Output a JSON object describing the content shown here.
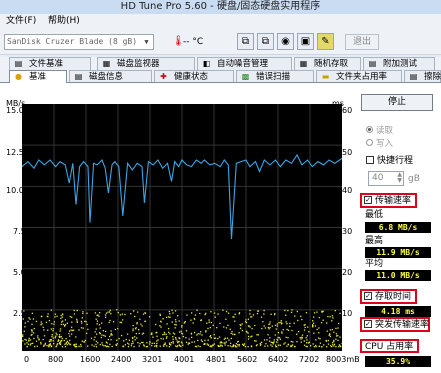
{
  "window": {
    "title": "HD Tune Pro 5.60 - 硬盘/固态硬盘实用程序"
  },
  "menu": {
    "file": "文件(F)",
    "help": "帮助(H)"
  },
  "toolbar": {
    "device": "SanDisk Cruzer Blade (8 gB)",
    "temp": "-- °C",
    "exit": "退出"
  },
  "tabs_row1": [
    "文件基准",
    "磁盘监视器",
    "自动噪音管理",
    "随机存取",
    "附加测试"
  ],
  "tabs_row2": [
    "基准",
    "磁盘信息",
    "健康状态",
    "错误扫描",
    "文件夹占用率",
    "擦除"
  ],
  "chart": {
    "left_unit": "MB/s",
    "right_unit": "ms",
    "left_ticks": [
      "15.0",
      "12.5",
      "10.0",
      "7.5",
      "5.0",
      "2.5"
    ],
    "right_ticks": [
      "60",
      "50",
      "40",
      "30",
      "20",
      "10"
    ],
    "x_ticks": [
      "0",
      "800",
      "1600",
      "2400",
      "3201",
      "4001",
      "4801",
      "5602",
      "6402",
      "7202",
      "8003mB"
    ]
  },
  "side": {
    "start": "停止",
    "read": "读取",
    "write": "写入",
    "short": "快捷行程",
    "short_val": "40",
    "short_unit": "gB",
    "transfer": "传输速率",
    "min_label": "最低",
    "min_val": "6.8 MB/s",
    "max_label": "最高",
    "max_val": "11.9 MB/s",
    "avg_label": "平均",
    "avg_val": "11.0 MB/s",
    "access": "存取时间",
    "access_val": "4.18 ms",
    "burst": "突发传输速率",
    "cpu": "CPU 占用率",
    "cpu_val": "35.9%"
  },
  "chart_data": {
    "type": "line",
    "xlabel": "",
    "ylabel": "MB/s",
    "ylabel_right": "ms",
    "xlim": [
      0,
      8003
    ],
    "ylim": [
      0,
      15
    ],
    "ylim_right": [
      0,
      60
    ],
    "grid": true,
    "series": [
      {
        "name": "传输速率",
        "color": "#3aa6e6",
        "x": [
          0,
          150,
          300,
          420,
          560,
          700,
          840,
          950,
          1080,
          1180,
          1270,
          1350,
          1440,
          1540,
          1650,
          1700,
          1790,
          1880,
          2000,
          2080,
          2160,
          2250,
          2320,
          2420,
          2520,
          2640,
          2760,
          2880,
          3000,
          3060,
          3160,
          3280,
          3400,
          3520,
          3640,
          3740,
          3820,
          3920,
          4000,
          4120,
          4240,
          4360,
          4480,
          4560,
          4700,
          4820,
          4960,
          5060,
          5160,
          5240,
          5360,
          5480,
          5600,
          5700,
          5840,
          5940,
          6060,
          6200,
          6340,
          6460,
          6600,
          6740,
          6880,
          7000,
          7140,
          7260,
          7400,
          7540,
          7680,
          7820,
          8003
        ],
        "y": [
          11.2,
          11.5,
          11.1,
          11.6,
          11.3,
          11.6,
          11.2,
          11.5,
          11.3,
          10.2,
          11.4,
          8.9,
          11.2,
          11.5,
          11.2,
          7.8,
          11.4,
          11.3,
          11.6,
          11.1,
          9.6,
          11.3,
          11.5,
          11.2,
          8.2,
          11.4,
          11.0,
          11.4,
          11.2,
          9.0,
          11.5,
          11.3,
          11.6,
          11.1,
          11.4,
          10.3,
          11.5,
          11.2,
          11.6,
          11.3,
          11.2,
          11.6,
          11.4,
          11.6,
          11.3,
          11.4,
          11.2,
          11.6,
          11.3,
          6.8,
          11.4,
          11.5,
          11.6,
          11.2,
          11.5,
          10.9,
          11.6,
          11.3,
          11.6,
          11.2,
          11.6,
          11.4,
          11.9,
          11.3,
          11.6,
          11.2,
          11.5,
          11.3,
          11.6,
          11.4,
          11.7
        ]
      },
      {
        "name": "存取时间",
        "type": "scatter",
        "axis": "right",
        "color": "#e8e830",
        "y_range_ms": [
          0,
          10
        ],
        "mean_ms": 4.18,
        "count": 800
      }
    ]
  }
}
